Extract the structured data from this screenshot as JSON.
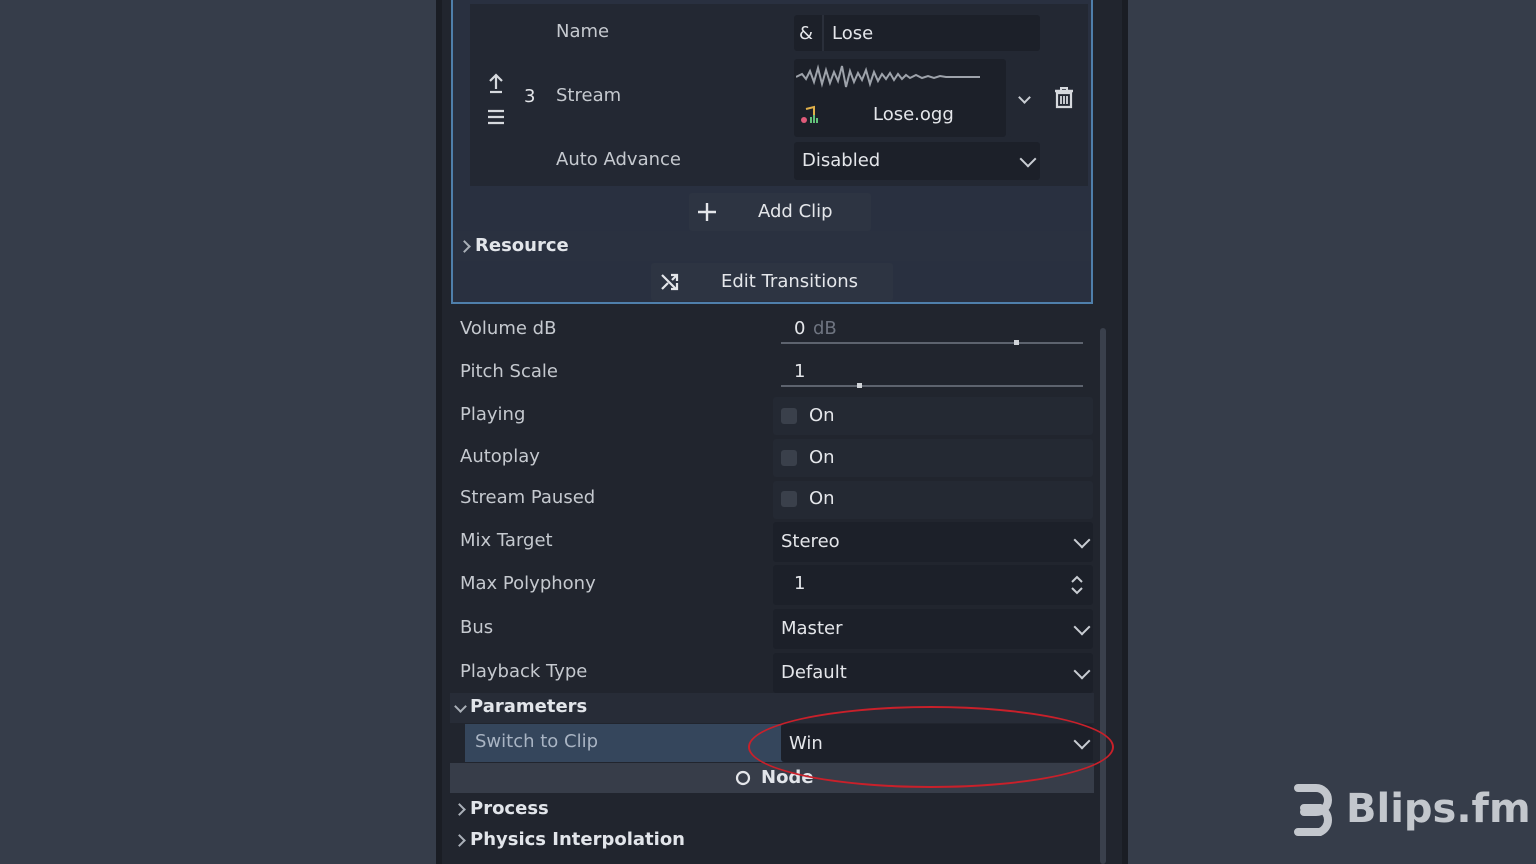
{
  "clip": {
    "index": "3",
    "name_label": "Name",
    "name_prefix": "&",
    "name_value": "Lose",
    "stream_label": "Stream",
    "stream_file": "Lose.ogg",
    "auto_advance_label": "Auto Advance",
    "auto_advance_value": "Disabled"
  },
  "buttons": {
    "add_clip": "Add Clip",
    "edit_transitions": "Edit Transitions"
  },
  "sections": {
    "resource": "Resource",
    "parameters": "Parameters",
    "node": "Node",
    "process": "Process",
    "physics_interpolation": "Physics Interpolation"
  },
  "properties": {
    "volume_db": {
      "label": "Volume dB",
      "value": "0",
      "unit": "dB",
      "slider_fraction": 0.77
    },
    "pitch_scale": {
      "label": "Pitch Scale",
      "value": "1",
      "slider_fraction": 0.25
    },
    "playing": {
      "label": "Playing",
      "checkbox": "On"
    },
    "autoplay": {
      "label": "Autoplay",
      "checkbox": "On"
    },
    "stream_paused": {
      "label": "Stream Paused",
      "checkbox": "On"
    },
    "mix_target": {
      "label": "Mix Target",
      "value": "Stereo"
    },
    "max_polyphony": {
      "label": "Max Polyphony",
      "value": "1"
    },
    "bus": {
      "label": "Bus",
      "value": "Master"
    },
    "playback_type": {
      "label": "Playback Type",
      "value": "Default"
    }
  },
  "parameters": {
    "switch_to_clip": {
      "label": "Switch to Clip",
      "value": "Win"
    }
  },
  "watermark": {
    "brand": "Blips.fm"
  },
  "colors": {
    "accent_border": "#4f7fab",
    "highlight": "#c9202a",
    "panel": "#21252e",
    "background": "#363d4a"
  },
  "icons": [
    "arrow-up-icon",
    "drag-handle-icon",
    "waveform-icon",
    "audio-file-icon",
    "trash-icon",
    "plus-icon",
    "shuffle-icon",
    "chevron-down-icon",
    "chevron-right-icon",
    "spin-arrows-icon",
    "node-circle-icon",
    "blips-logo-icon"
  ]
}
